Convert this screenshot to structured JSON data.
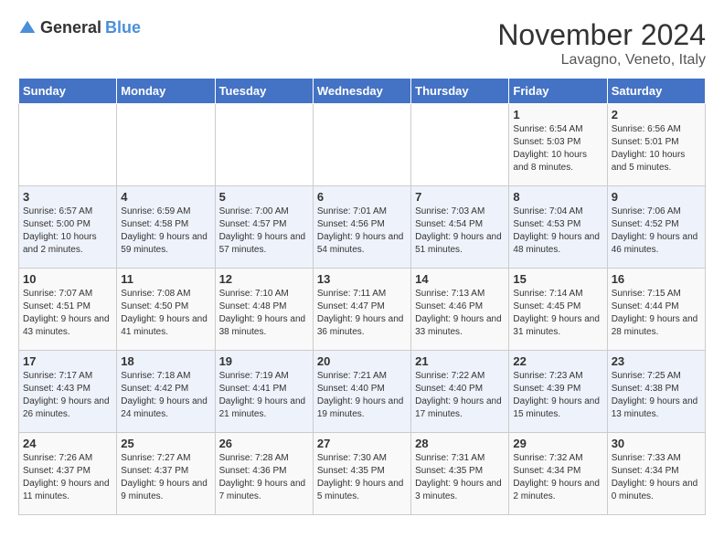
{
  "logo": {
    "general": "General",
    "blue": "Blue"
  },
  "title": "November 2024",
  "location": "Lavagno, Veneto, Italy",
  "days_of_week": [
    "Sunday",
    "Monday",
    "Tuesday",
    "Wednesday",
    "Thursday",
    "Friday",
    "Saturday"
  ],
  "weeks": [
    [
      {
        "day": "",
        "info": ""
      },
      {
        "day": "",
        "info": ""
      },
      {
        "day": "",
        "info": ""
      },
      {
        "day": "",
        "info": ""
      },
      {
        "day": "",
        "info": ""
      },
      {
        "day": "1",
        "info": "Sunrise: 6:54 AM\nSunset: 5:03 PM\nDaylight: 10 hours and 8 minutes."
      },
      {
        "day": "2",
        "info": "Sunrise: 6:56 AM\nSunset: 5:01 PM\nDaylight: 10 hours and 5 minutes."
      }
    ],
    [
      {
        "day": "3",
        "info": "Sunrise: 6:57 AM\nSunset: 5:00 PM\nDaylight: 10 hours and 2 minutes."
      },
      {
        "day": "4",
        "info": "Sunrise: 6:59 AM\nSunset: 4:58 PM\nDaylight: 9 hours and 59 minutes."
      },
      {
        "day": "5",
        "info": "Sunrise: 7:00 AM\nSunset: 4:57 PM\nDaylight: 9 hours and 57 minutes."
      },
      {
        "day": "6",
        "info": "Sunrise: 7:01 AM\nSunset: 4:56 PM\nDaylight: 9 hours and 54 minutes."
      },
      {
        "day": "7",
        "info": "Sunrise: 7:03 AM\nSunset: 4:54 PM\nDaylight: 9 hours and 51 minutes."
      },
      {
        "day": "8",
        "info": "Sunrise: 7:04 AM\nSunset: 4:53 PM\nDaylight: 9 hours and 48 minutes."
      },
      {
        "day": "9",
        "info": "Sunrise: 7:06 AM\nSunset: 4:52 PM\nDaylight: 9 hours and 46 minutes."
      }
    ],
    [
      {
        "day": "10",
        "info": "Sunrise: 7:07 AM\nSunset: 4:51 PM\nDaylight: 9 hours and 43 minutes."
      },
      {
        "day": "11",
        "info": "Sunrise: 7:08 AM\nSunset: 4:50 PM\nDaylight: 9 hours and 41 minutes."
      },
      {
        "day": "12",
        "info": "Sunrise: 7:10 AM\nSunset: 4:48 PM\nDaylight: 9 hours and 38 minutes."
      },
      {
        "day": "13",
        "info": "Sunrise: 7:11 AM\nSunset: 4:47 PM\nDaylight: 9 hours and 36 minutes."
      },
      {
        "day": "14",
        "info": "Sunrise: 7:13 AM\nSunset: 4:46 PM\nDaylight: 9 hours and 33 minutes."
      },
      {
        "day": "15",
        "info": "Sunrise: 7:14 AM\nSunset: 4:45 PM\nDaylight: 9 hours and 31 minutes."
      },
      {
        "day": "16",
        "info": "Sunrise: 7:15 AM\nSunset: 4:44 PM\nDaylight: 9 hours and 28 minutes."
      }
    ],
    [
      {
        "day": "17",
        "info": "Sunrise: 7:17 AM\nSunset: 4:43 PM\nDaylight: 9 hours and 26 minutes."
      },
      {
        "day": "18",
        "info": "Sunrise: 7:18 AM\nSunset: 4:42 PM\nDaylight: 9 hours and 24 minutes."
      },
      {
        "day": "19",
        "info": "Sunrise: 7:19 AM\nSunset: 4:41 PM\nDaylight: 9 hours and 21 minutes."
      },
      {
        "day": "20",
        "info": "Sunrise: 7:21 AM\nSunset: 4:40 PM\nDaylight: 9 hours and 19 minutes."
      },
      {
        "day": "21",
        "info": "Sunrise: 7:22 AM\nSunset: 4:40 PM\nDaylight: 9 hours and 17 minutes."
      },
      {
        "day": "22",
        "info": "Sunrise: 7:23 AM\nSunset: 4:39 PM\nDaylight: 9 hours and 15 minutes."
      },
      {
        "day": "23",
        "info": "Sunrise: 7:25 AM\nSunset: 4:38 PM\nDaylight: 9 hours and 13 minutes."
      }
    ],
    [
      {
        "day": "24",
        "info": "Sunrise: 7:26 AM\nSunset: 4:37 PM\nDaylight: 9 hours and 11 minutes."
      },
      {
        "day": "25",
        "info": "Sunrise: 7:27 AM\nSunset: 4:37 PM\nDaylight: 9 hours and 9 minutes."
      },
      {
        "day": "26",
        "info": "Sunrise: 7:28 AM\nSunset: 4:36 PM\nDaylight: 9 hours and 7 minutes."
      },
      {
        "day": "27",
        "info": "Sunrise: 7:30 AM\nSunset: 4:35 PM\nDaylight: 9 hours and 5 minutes."
      },
      {
        "day": "28",
        "info": "Sunrise: 7:31 AM\nSunset: 4:35 PM\nDaylight: 9 hours and 3 minutes."
      },
      {
        "day": "29",
        "info": "Sunrise: 7:32 AM\nSunset: 4:34 PM\nDaylight: 9 hours and 2 minutes."
      },
      {
        "day": "30",
        "info": "Sunrise: 7:33 AM\nSunset: 4:34 PM\nDaylight: 9 hours and 0 minutes."
      }
    ]
  ]
}
